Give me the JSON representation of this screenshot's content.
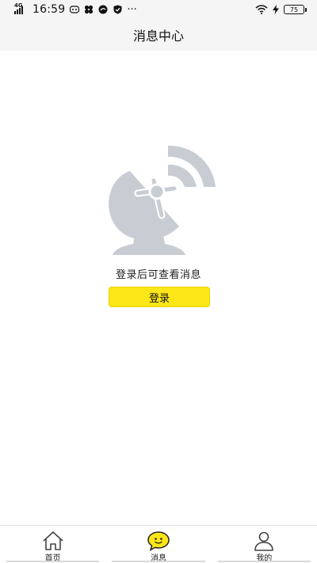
{
  "status_bar": {
    "network": "4G",
    "time": "16:59",
    "more": "···",
    "battery": "75"
  },
  "header": {
    "title": "消息中心"
  },
  "empty_state": {
    "icon": "satellite-dish-icon",
    "message": "登录后可查看消息",
    "login_label": "登录"
  },
  "tabbar": {
    "tabs": [
      {
        "label": "首页",
        "icon": "home-icon"
      },
      {
        "label": "消息",
        "icon": "message-smile-icon",
        "active": true
      },
      {
        "label": "我的",
        "icon": "user-icon"
      }
    ]
  },
  "colors": {
    "accent": "#fde617",
    "icon_gray": "#c8cdd3",
    "header_bg": "#f5f5f5"
  }
}
